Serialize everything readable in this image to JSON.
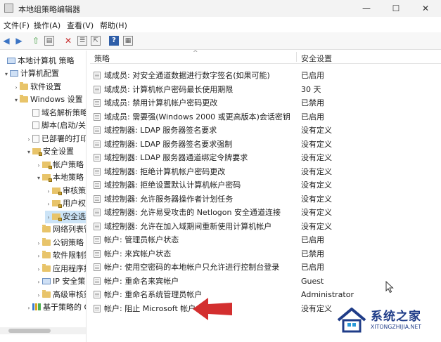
{
  "window": {
    "title": "本地组策略编辑器",
    "controls": {
      "minimize": "—",
      "maximize": "☐",
      "close": "✕"
    }
  },
  "menubar": {
    "items": [
      "文件(F)",
      "操作(A)",
      "查看(V)",
      "帮助(H)"
    ]
  },
  "toolbar": {
    "buttons": [
      "back-icon",
      "forward-icon",
      "up-folder-icon",
      "show-hide-tree-icon",
      "delete-icon",
      "properties-icon",
      "export-list-icon",
      "help-icon",
      "view-icon"
    ]
  },
  "tree": {
    "items": [
      {
        "label": "本地计算机 策略",
        "expander": "",
        "icon": "computer-policy-icon"
      },
      {
        "label": "计算机配置",
        "expander": "▾",
        "icon": "computer-icon"
      },
      {
        "label": "软件设置",
        "expander": "›",
        "icon": "folder-icon"
      },
      {
        "label": "Windows 设置",
        "expander": "▾",
        "icon": "folder-icon"
      },
      {
        "label": "域名解析策略",
        "expander": "",
        "icon": "document-icon"
      },
      {
        "label": "脚本(启动/关机)",
        "expander": "",
        "icon": "document-icon"
      },
      {
        "label": "已部署的打印机",
        "expander": "›",
        "icon": "document-icon"
      },
      {
        "label": "安全设置",
        "expander": "▾",
        "icon": "lock-folder-icon"
      },
      {
        "label": "帐户策略",
        "expander": "›",
        "icon": "lock-folder-icon"
      },
      {
        "label": "本地策略",
        "expander": "▾",
        "icon": "lock-folder-icon"
      },
      {
        "label": "审核策略",
        "expander": "›",
        "icon": "lock-folder-icon"
      },
      {
        "label": "用户权限分配",
        "expander": "›",
        "icon": "lock-folder-icon"
      },
      {
        "label": "安全选项",
        "expander": "›",
        "icon": "lock-folder-icon"
      },
      {
        "label": "网络列表管理器策略",
        "expander": "",
        "icon": "folder-icon"
      },
      {
        "label": "公钥策略",
        "expander": "›",
        "icon": "folder-icon"
      },
      {
        "label": "软件限制策略",
        "expander": "›",
        "icon": "folder-icon"
      },
      {
        "label": "应用程序控制策略",
        "expander": "›",
        "icon": "folder-icon"
      },
      {
        "label": "IP 安全策略",
        "expander": "›",
        "icon": "shield-icon"
      },
      {
        "label": "高级审核策略配置",
        "expander": "›",
        "icon": "folder-icon"
      },
      {
        "label": "基于策略的 QoS",
        "expander": "›",
        "icon": "chart-icon"
      }
    ]
  },
  "list": {
    "columns": {
      "policy": "策略",
      "setting": "安全设置"
    },
    "rows": [
      {
        "policy": "域成员: 对安全通道数据进行数字签名(如果可能)",
        "setting": "已启用"
      },
      {
        "policy": "域成员: 计算机帐户密码最长使用期限",
        "setting": "30 天"
      },
      {
        "policy": "域成员: 禁用计算机帐户密码更改",
        "setting": "已禁用"
      },
      {
        "policy": "域成员: 需要强(Windows 2000 或更高版本)会话密钥",
        "setting": "已启用"
      },
      {
        "policy": "域控制器: LDAP 服务器签名要求",
        "setting": "没有定义"
      },
      {
        "policy": "域控制器: LDAP 服务器签名要求强制",
        "setting": "没有定义"
      },
      {
        "policy": "域控制器: LDAP 服务器通道绑定令牌要求",
        "setting": "没有定义"
      },
      {
        "policy": "域控制器: 拒绝计算机帐户密码更改",
        "setting": "没有定义"
      },
      {
        "policy": "域控制器: 拒绝设置默认计算机帐户密码",
        "setting": "没有定义"
      },
      {
        "policy": "域控制器: 允许服务器操作者计划任务",
        "setting": "没有定义"
      },
      {
        "policy": "域控制器: 允许易受攻击的 Netlogon 安全通道连接",
        "setting": "没有定义"
      },
      {
        "policy": "域控制器: 允许在加入域期间重新使用计算机帐户",
        "setting": "没有定义"
      },
      {
        "policy": "帐户: 管理员帐户状态",
        "setting": "已启用"
      },
      {
        "policy": "帐户: 来宾帐户状态",
        "setting": "已禁用"
      },
      {
        "policy": "帐户: 使用空密码的本地帐户只允许进行控制台登录",
        "setting": "已启用"
      },
      {
        "policy": "帐户: 重命名来宾帐户",
        "setting": "Guest"
      },
      {
        "policy": "帐户: 重命名系统管理员帐户",
        "setting": "Administrator"
      },
      {
        "policy": "帐户: 阻止 Microsoft 帐户",
        "setting": "没有定义"
      }
    ]
  },
  "annotation": {
    "arrow_color": "#d32f2f",
    "points_to": "帐户: 阻止 Microsoft 帐户"
  },
  "watermark": {
    "name": "系统之家",
    "url": "XITONGZHIJIA.NET",
    "color": "#1f3c88"
  }
}
